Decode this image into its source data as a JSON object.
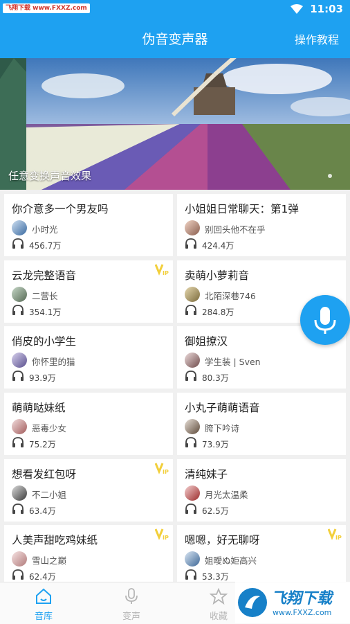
{
  "status_bar": {
    "watermark": "飞翔下载 www.FXXZ.com",
    "time": "11:03"
  },
  "app_bar": {
    "title": "伪音变声器",
    "tutorial_label": "操作教程"
  },
  "banner": {
    "caption": "任意变换声音效果"
  },
  "cards": [
    {
      "title": "你介意多一个男友吗",
      "author": "小时光",
      "plays": "456.7万",
      "vip": false
    },
    {
      "title": "小姐姐日常聊天：第1弹",
      "author": "别回头他不在乎",
      "plays": "424.4万",
      "vip": false
    },
    {
      "title": "云龙完整语音",
      "author": "二营长",
      "plays": "354.1万",
      "vip": true
    },
    {
      "title": "卖萌小萝莉音",
      "author": "北陌深巷746",
      "plays": "284.8万",
      "vip": false
    },
    {
      "title": "俏皮的小学生",
      "author": "你怀里的猫",
      "plays": "93.9万",
      "vip": false
    },
    {
      "title": "御姐撩汉",
      "author": "学生装 | Sven",
      "plays": "80.3万",
      "vip": false
    },
    {
      "title": "萌萌哒妹纸",
      "author": "恶毒少女",
      "plays": "75.2万",
      "vip": false
    },
    {
      "title": "小丸子萌萌语音",
      "author": "胯下吟诗",
      "plays": "73.9万",
      "vip": false
    },
    {
      "title": "想看发红包呀",
      "author": "不二小姐",
      "plays": "63.4万",
      "vip": true
    },
    {
      "title": "清纯妹子",
      "author": "月光太温柔",
      "plays": "62.5万",
      "vip": false
    },
    {
      "title": "人美声甜吃鸡妹纸",
      "author": "雪山之巅",
      "plays": "62.4万",
      "vip": true
    },
    {
      "title": "嗯嗯，好无聊呀",
      "author": "姐曖ぬ姖高兴",
      "plays": "53.3万",
      "vip": true
    }
  ],
  "bottom_nav": [
    {
      "label": "音库",
      "icon": "home-icon",
      "active": true
    },
    {
      "label": "变声",
      "icon": "mic-icon",
      "active": false
    },
    {
      "label": "收藏",
      "icon": "star-icon",
      "active": false
    }
  ],
  "bottom_watermark": {
    "brand": "飞翔下载",
    "url": "www.FXXZ.com"
  },
  "colors": {
    "accent": "#1ea1f1",
    "vip": "#f2cf3b",
    "inactive": "#b5b5b5"
  }
}
